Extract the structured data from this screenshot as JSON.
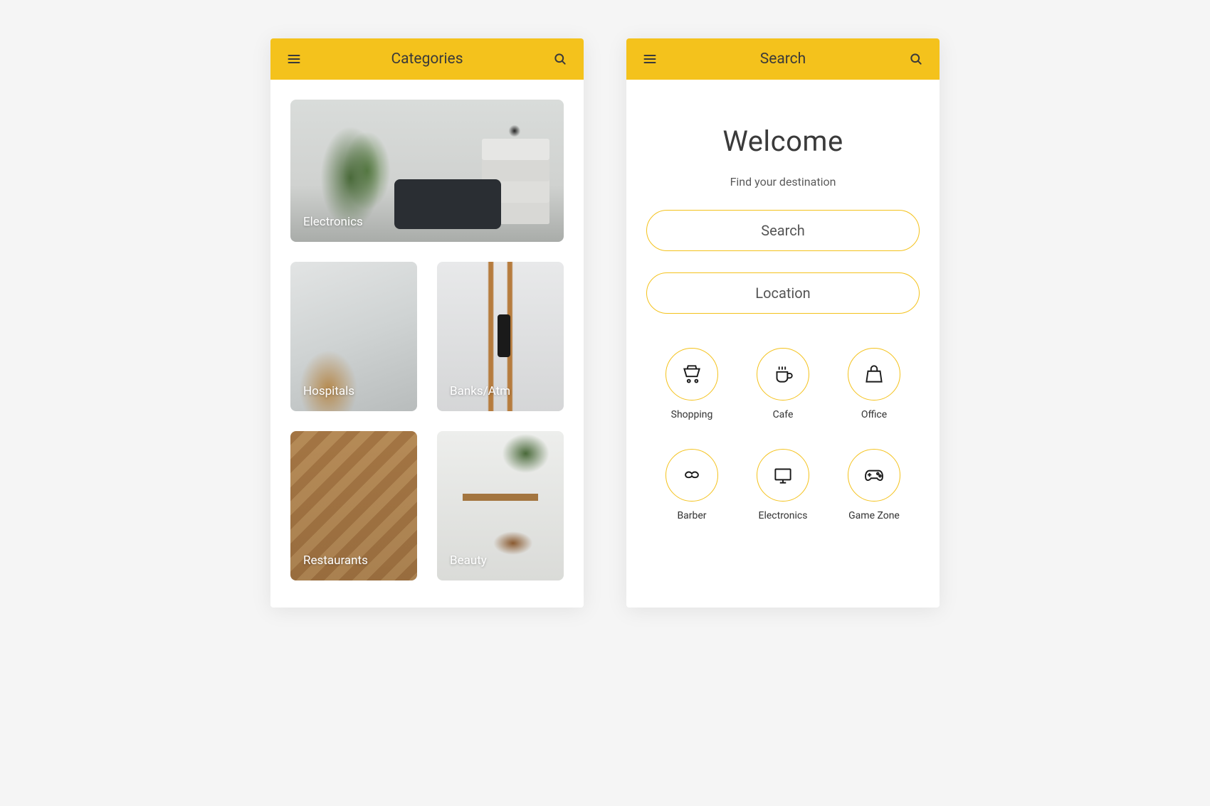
{
  "colors": {
    "accent": "#f4c21c"
  },
  "left": {
    "title": "Categories",
    "hero": {
      "label": "Electronics",
      "icon": "interior-room"
    },
    "cards": [
      {
        "label": "Hospitals",
        "icon": "waiting-room"
      },
      {
        "label": "Banks/Atm",
        "icon": "retail-store"
      },
      {
        "label": "Restaurants",
        "icon": "staircase"
      },
      {
        "label": "Beauty",
        "icon": "counter-stool"
      }
    ]
  },
  "right": {
    "title": "Search",
    "welcome_title": "Welcome",
    "welcome_sub": "Find your destination",
    "search_placeholder": "Search",
    "location_placeholder": "Location",
    "categories": [
      {
        "label": "Shopping",
        "icon": "cart-icon"
      },
      {
        "label": "Cafe",
        "icon": "coffee-icon"
      },
      {
        "label": "Office",
        "icon": "bag-icon"
      },
      {
        "label": "Barber",
        "icon": "mustache-icon"
      },
      {
        "label": "Electronics",
        "icon": "monitor-icon"
      },
      {
        "label": "Game Zone",
        "icon": "gamepad-icon"
      }
    ]
  }
}
